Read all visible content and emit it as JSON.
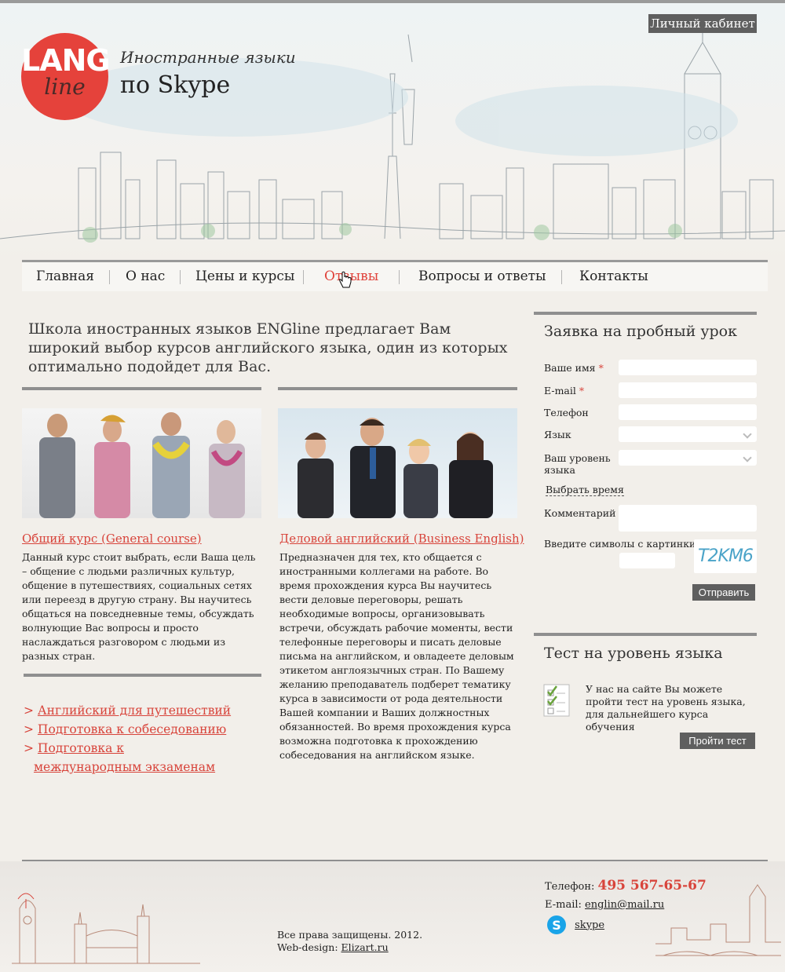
{
  "header": {
    "logo_top": "LANG",
    "logo_bottom": "line",
    "tagline": "Иностранные языки",
    "subtitle": "по Skype",
    "cabinet_label": "Личный кабинет"
  },
  "nav": {
    "items": [
      "Главная",
      "О нас",
      "Цены и курсы",
      "Отзывы",
      "Вопросы и ответы",
      "Контакты"
    ],
    "active": "Отзывы"
  },
  "intro": "Школа иностранных языков ENGline предлагает Вам широкий выбор курсов английского языка, один из которых оптимально подойдет для Вас.",
  "courses": [
    {
      "title": "Общий курс (General course)",
      "text": "Данный курс стоит выбрать, если Ваша цель – общение с людьми различных культур, общение в путешествиях, социальных сетях или переезд в другую страну. Вы научитесь общаться на повседневные темы, обсуждать волнующие Вас вопросы и просто наслаждаться разговором с людьми из разных стран."
    },
    {
      "title": "Деловой английский (Business English)",
      "text": "Предназначен для тех, кто общается с иностранными коллегами на работе.  Во время прохождения курса Вы научитесь вести деловые переговоры, решать необходимые вопросы, организовывать встречи, обсуждать рабочие моменты, вести телефонные переговоры и писать деловые письма на английском, и овладеете деловым этикетом англоязычных стран. По Вашему желанию преподаватель подберет тематику курса в зависимости от рода деятельности Вашей компании и Ваших должностных обязанностей. Во время прохождения курса возможна подготовка к прохождению собеседования на английском языке."
    }
  ],
  "extra_links": [
    "Английский для путешествий",
    "Подготовка к собеседованию",
    "Подготовка к международным экзаменам"
  ],
  "form": {
    "title": "Заявка на пробный урок",
    "name_label": "Ваше имя",
    "email_label": "E-mail",
    "phone_label": "Телефон",
    "lang_label": "Язык",
    "level_label": "Ваш уровень языка",
    "time_link": "Выбрать время",
    "comment_label": "Комментарий",
    "captcha_label": "Введите символы с картинки",
    "captcha_text": "T2KM6",
    "submit": "Отправить"
  },
  "test": {
    "title": "Тест на уровень языка",
    "text": "У нас на сайте Вы можете пройти тест на уровень языка, для дальнейшего курса обучения",
    "button": "Пройти тест"
  },
  "footer": {
    "copyright": "Все права защищены. 2012.",
    "design_prefix": "Web-design:",
    "design_link": "Elizart.ru",
    "phone_label": "Телефон:",
    "phone": "495 567-65-67",
    "email_label": "E-mail:",
    "email": "englin@mail.ru",
    "skype": "skype"
  },
  "colors": {
    "accent": "#e5423b",
    "button": "#5f5f5f",
    "background": "#f2efea"
  }
}
